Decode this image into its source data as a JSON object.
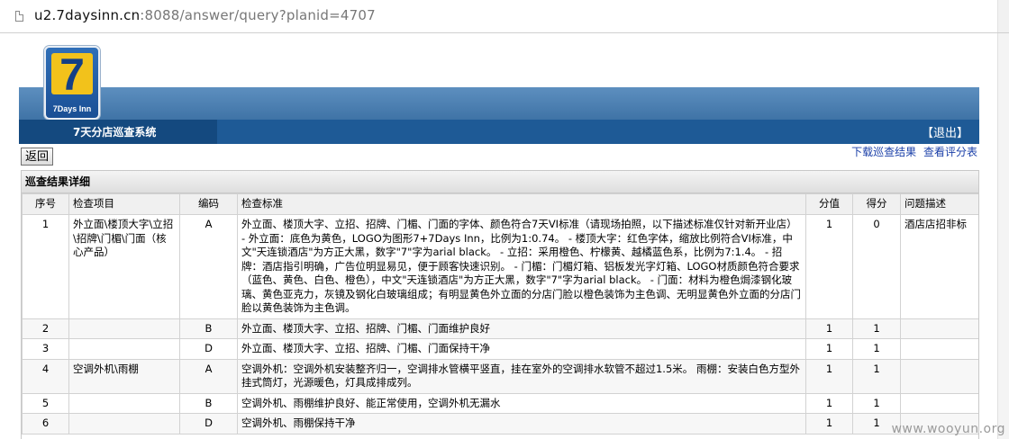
{
  "browser": {
    "url_host": "u2.7daysinn.cn",
    "url_rest": ":8088/answer/query?planid=4707"
  },
  "header": {
    "logo_number": "7",
    "logo_brand": "7Days Inn",
    "system_title": "7天分店巡查系统",
    "logout": "【退出】"
  },
  "toolbar": {
    "back": "返回",
    "download": "下载巡查结果",
    "view_score": "查看评分表"
  },
  "panel": {
    "title": "巡查结果详细",
    "columns": [
      "序号",
      "检查项目",
      "编码",
      "检查标准",
      "分值",
      "得分",
      "问题描述"
    ],
    "rows": [
      {
        "no": "1",
        "item": "外立面\\楼顶大字\\立招\\招牌\\门楣\\门面（核心产品）",
        "code": "A",
        "standard": "外立面、楼顶大字、立招、招牌、门楣、门面的字体、颜色符合7天VI标准（请现场拍照，以下描述标准仅针对新开业店） - 外立面：底色为黄色，LOGO为图形7+7Days Inn，比例为1:0.74。 - 楼顶大字：红色字体，缩放比例符合VI标准，中文\"天连锁酒店\"为方正大黑，数字\"7\"字为arial black。 - 立招：采用橙色、柠檬黄、越橘蓝色系，比例为7:1.4。 - 招牌：酒店指引明确，广告位明显易见，便于顾客快速识别。 - 门楣：门楣灯箱、铝板发光字灯箱、LOGO材质颜色符合要求（蓝色、黄色、白色、橙色），中文\"天连锁酒店\"为方正大黑，数字\"7\"字为arial black。 - 门面：材料为橙色焗漆钢化玻璃、黄色亚克力，灰镜及钢化白玻璃组成；有明显黄色外立面的分店门脸以橙色装饰为主色调、无明显黄色外立面的分店门脸以黄色装饰为主色调。",
        "value": "1",
        "score": "0",
        "issue": "酒店店招非标"
      },
      {
        "no": "2",
        "item": "",
        "code": "B",
        "standard": "外立面、楼顶大字、立招、招牌、门楣、门面维护良好",
        "value": "1",
        "score": "1",
        "issue": ""
      },
      {
        "no": "3",
        "item": "",
        "code": "D",
        "standard": "外立面、楼顶大字、立招、招牌、门楣、门面保持干净",
        "value": "1",
        "score": "1",
        "issue": ""
      },
      {
        "no": "4",
        "item": "空调外机\\雨棚",
        "code": "A",
        "standard": "空调外机：空调外机安装整齐归一，空调排水管横平竖直，挂在室外的空调排水软管不超过1.5米。 雨棚：安装白色方型外挂式筒灯，光源暖色，灯具成排成列。",
        "value": "1",
        "score": "1",
        "issue": ""
      },
      {
        "no": "5",
        "item": "",
        "code": "B",
        "standard": "空调外机、雨棚维护良好、能正常使用，空调外机无漏水",
        "value": "1",
        "score": "1",
        "issue": ""
      },
      {
        "no": "6",
        "item": "",
        "code": "D",
        "standard": "空调外机、雨棚保持干净",
        "value": "1",
        "score": "1",
        "issue": ""
      }
    ]
  },
  "watermark": "www.wooyun.org"
}
